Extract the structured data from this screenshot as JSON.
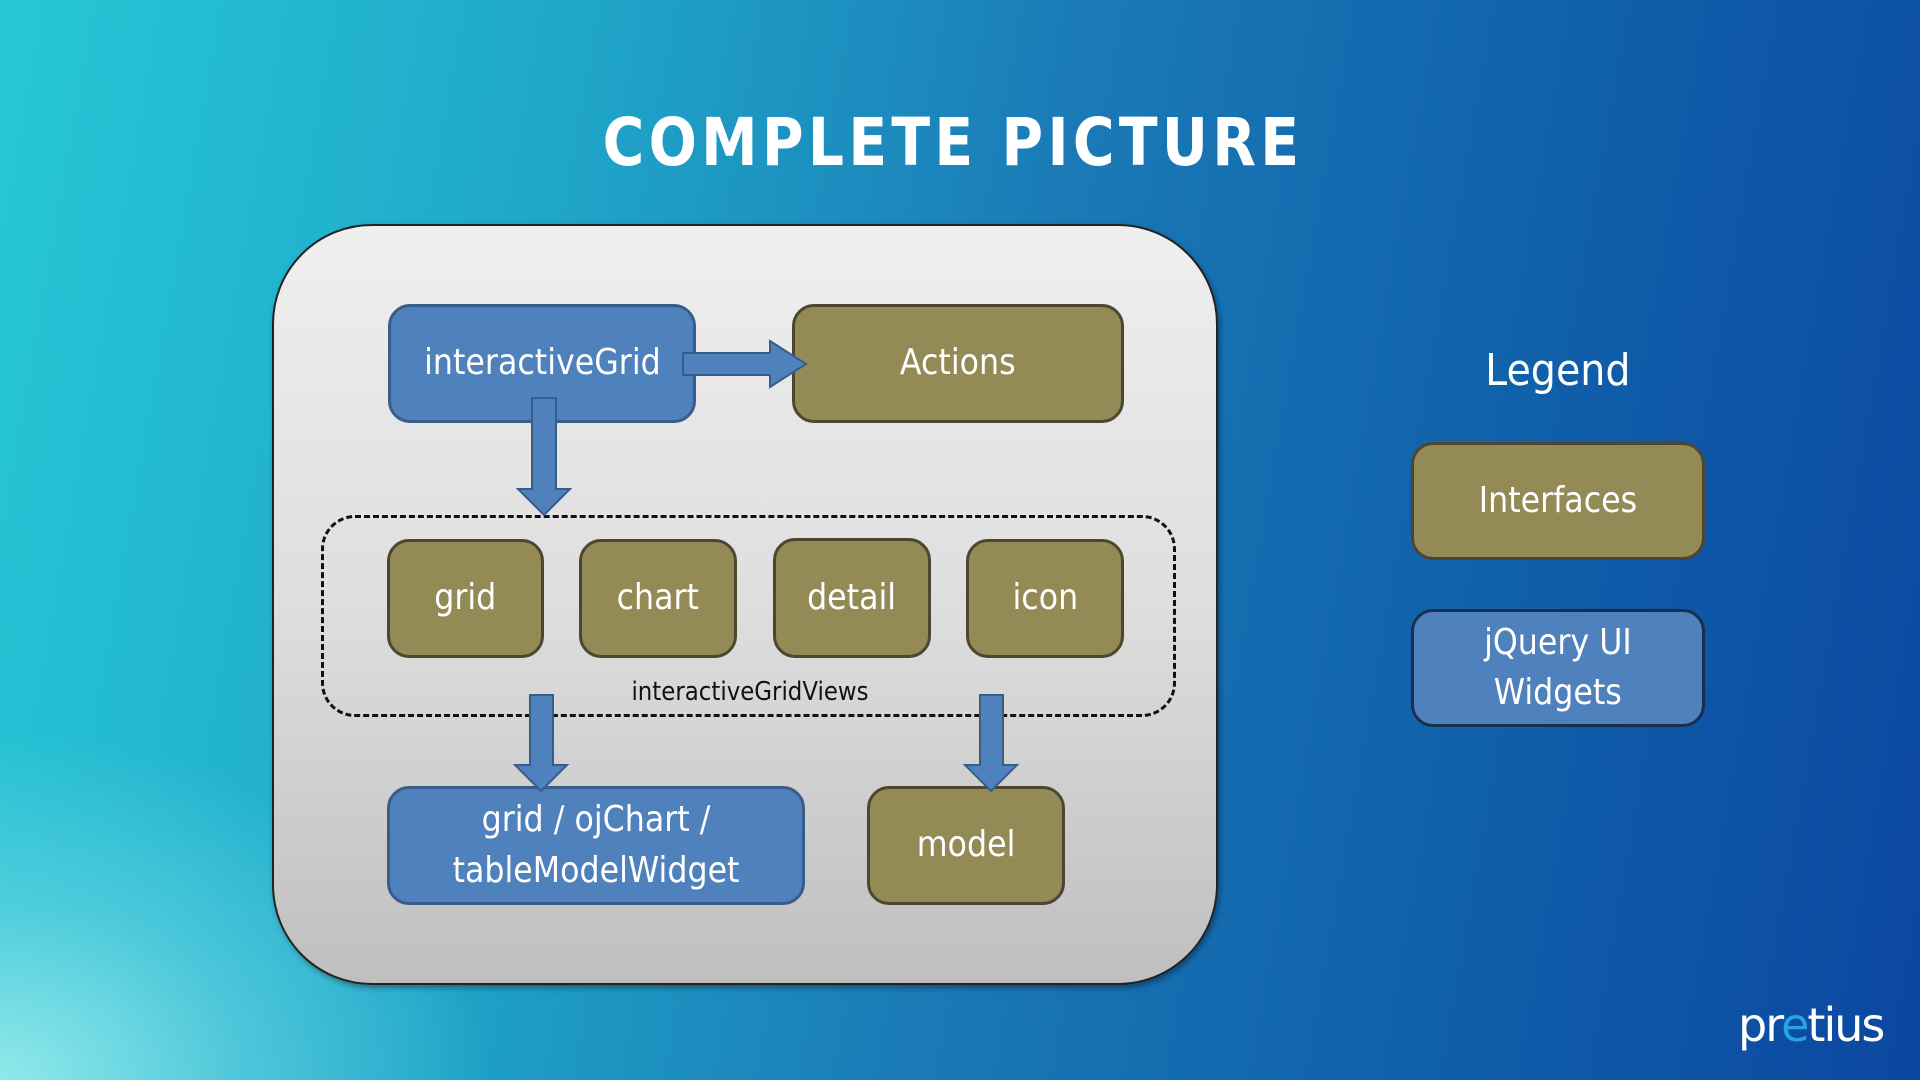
{
  "slide": {
    "title": "COMPLETE PICTURE"
  },
  "diagram": {
    "top": {
      "interactive_grid": "interactiveGrid",
      "actions": "Actions"
    },
    "views_group_label": "interactiveGridViews",
    "views": [
      "grid",
      "chart",
      "detail",
      "icon"
    ],
    "bottom": {
      "widgets_line1": "grid / ojChart /",
      "widgets_line2": "tableModelWidget",
      "model": "model"
    }
  },
  "legend": {
    "title": "Legend",
    "items": [
      {
        "label": "Interfaces",
        "kind": "interface",
        "color": "#948a55"
      },
      {
        "label_line1": "jQuery UI",
        "label_line2": "Widgets",
        "kind": "widget",
        "color": "#4f81bd"
      }
    ]
  },
  "branding": {
    "logo_part1": "pr",
    "logo_accent": "e",
    "logo_part2": "tius"
  },
  "colors": {
    "interface": "#948a55",
    "widget": "#4f81bd",
    "arrow": "#4f81bd"
  }
}
